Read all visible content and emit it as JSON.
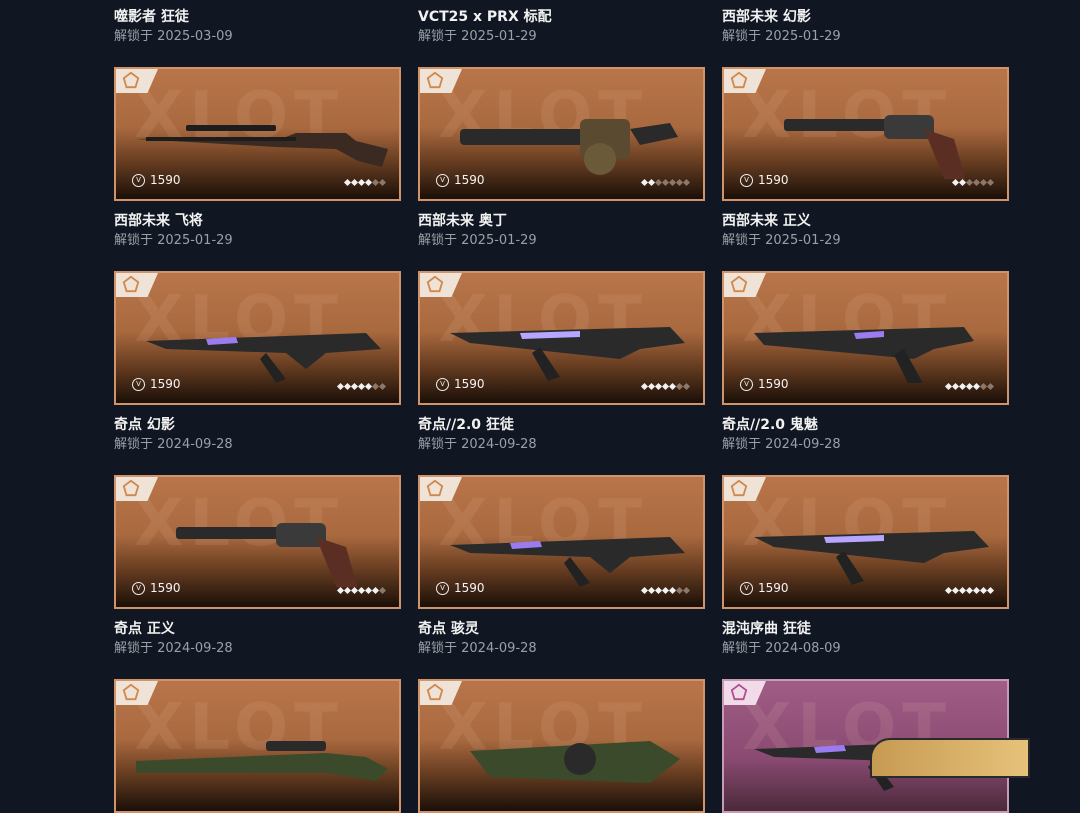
{
  "rows": [
    {
      "titles": [
        {
          "name": "噬影者 狂徒",
          "date": "解锁于 2025-03-09"
        },
        {
          "name": "VCT25 x PRX 标配",
          "date": "解锁于 2025-01-29"
        },
        {
          "name": "西部未来 幻影",
          "date": "解锁于 2025-01-29"
        }
      ]
    },
    {
      "cards": [
        {
          "price": "1590",
          "levels": 4,
          "level_total": 6,
          "weapon_icon": "lever-rifle-icon"
        },
        {
          "price": "1590",
          "levels": 2,
          "level_total": 7,
          "weapon_icon": "gatling-gun-icon"
        },
        {
          "price": "1590",
          "levels": 2,
          "level_total": 6,
          "weapon_icon": "revolver-icon"
        }
      ],
      "titles": [
        {
          "name": "西部未来 飞将",
          "date": "解锁于 2025-01-29"
        },
        {
          "name": "西部未来 奥丁",
          "date": "解锁于 2025-01-29"
        },
        {
          "name": "西部未来 正义",
          "date": "解锁于 2025-01-29"
        }
      ]
    },
    {
      "cards": [
        {
          "price": "1590",
          "levels": 5,
          "level_total": 7,
          "weapon_icon": "rifle-icon"
        },
        {
          "price": "1590",
          "levels": 5,
          "level_total": 7,
          "weapon_icon": "smg-icon"
        },
        {
          "price": "1590",
          "levels": 5,
          "level_total": 7,
          "weapon_icon": "pistol-icon"
        }
      ],
      "titles": [
        {
          "name": "奇点 幻影",
          "date": "解锁于 2024-09-28"
        },
        {
          "name": "奇点//2.0 狂徒",
          "date": "解锁于 2024-09-28"
        },
        {
          "name": "奇点//2.0 鬼魅",
          "date": "解锁于 2024-09-28"
        }
      ]
    },
    {
      "cards": [
        {
          "price": "1590",
          "levels": 6,
          "level_total": 7,
          "weapon_icon": "revolver-icon"
        },
        {
          "price": "1590",
          "levels": 5,
          "level_total": 7,
          "weapon_icon": "rifle-icon"
        },
        {
          "price": "1590",
          "levels": 7,
          "level_total": 7,
          "weapon_icon": "smg-icon"
        }
      ],
      "titles": [
        {
          "name": "奇点 正义",
          "date": "解锁于 2024-09-28"
        },
        {
          "name": "奇点 骇灵",
          "date": "解锁于 2024-09-28"
        },
        {
          "name": "混沌序曲 狂徒",
          "date": "解锁于 2024-08-09"
        }
      ]
    },
    {
      "cards": [
        {
          "weapon_icon": "sniper-rifle-icon"
        },
        {
          "weapon_icon": "shotgun-icon"
        },
        {
          "weapon_icon": "rifle-icon",
          "premium": true
        }
      ]
    }
  ],
  "card_watermark": "XLOT",
  "tier_icon": "pentagon-tier-icon",
  "currency_icon": "valorant-points-icon",
  "currency_glyph": "V",
  "claim_button_label": "",
  "colors": {
    "background": "#111722",
    "card_border": "#d0936a",
    "card_fill": "#b9754a",
    "premium_border": "#c79ab6",
    "premium_fill": "#a05d86"
  }
}
